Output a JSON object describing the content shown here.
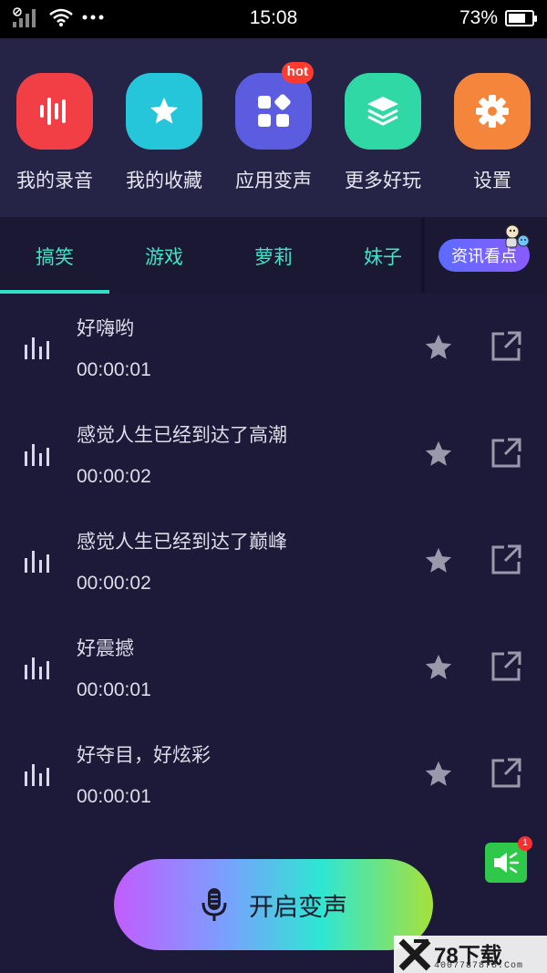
{
  "status_bar": {
    "time": "15:08",
    "battery": "73%",
    "battery_level": 0.73
  },
  "apps": [
    {
      "label": "我的录音",
      "icon": "soundwave-icon",
      "color": "#f13f45"
    },
    {
      "label": "我的收藏",
      "icon": "star-icon",
      "color": "#26c6da"
    },
    {
      "label": "应用变声",
      "icon": "apps-grid-icon",
      "color": "#5b5ce0",
      "badge": "hot"
    },
    {
      "label": "更多好玩",
      "icon": "layers-icon",
      "color": "#2fd8a4"
    },
    {
      "label": "设置",
      "icon": "gear-icon",
      "color": "#f5853a"
    }
  ],
  "tabs": [
    "搞笑",
    "游戏",
    "萝莉",
    "妹子"
  ],
  "active_tab": "搞笑",
  "news_button": "资讯看点",
  "recordings": [
    {
      "title": "好嗨哟",
      "duration": "00:00:01"
    },
    {
      "title": "感觉人生已经到达了高潮",
      "duration": "00:00:02"
    },
    {
      "title": "感觉人生已经到达了巅峰",
      "duration": "00:00:02"
    },
    {
      "title": "好震撼",
      "duration": "00:00:01"
    },
    {
      "title": "好夺目，好炫彩",
      "duration": "00:00:01"
    }
  ],
  "speaker_badge": "1",
  "start_button": "开启变声",
  "watermark": {
    "title": "78下载",
    "sub": "4007787878.Com"
  }
}
